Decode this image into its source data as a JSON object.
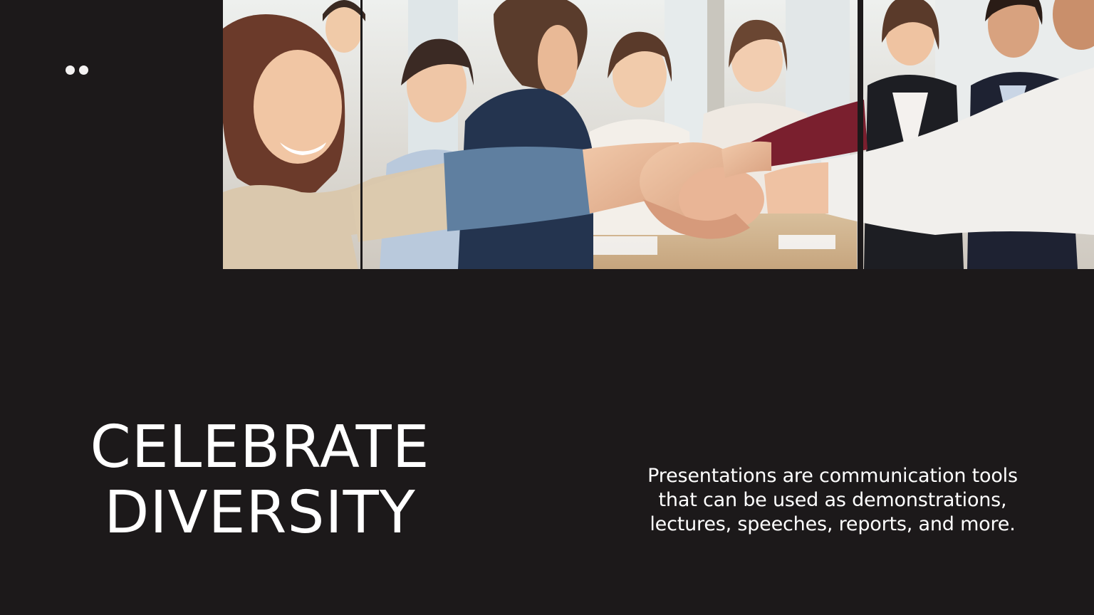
{
  "slide": {
    "title_line1": "CELEBRATE",
    "title_line2": "DIVERSITY",
    "body": "Presentations are communication tools that can be used as demonstrations, lectures, speeches, reports, and more."
  },
  "decor": {
    "dots_icon": "two-dots-icon"
  },
  "colors": {
    "background": "#1c191a",
    "text": "#ffffff"
  }
}
